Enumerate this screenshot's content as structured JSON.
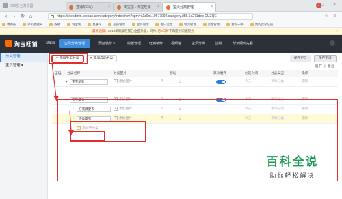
{
  "browser": {
    "app_title": "360安全浏览器",
    "tabs": [
      {
        "label": "直通车中心"
      },
      {
        "label": "淘宝店 - 淘宝旺铺"
      },
      {
        "label": "宝贝分类管理"
      }
    ],
    "notification_count": "4",
    "url": "https://siteadmin.taobao.com/category/index.htm?spm=a1z0m.10677092.category.d55.6a271deb CUZQE",
    "bookmarks": [
      "收藏夹",
      "手机收藏夹",
      "谷歌",
      "淘宝网",
      "直通车",
      "店铺管理",
      "宝贝管理",
      "客户运营",
      "物流管理",
      "资金管理",
      "我的千牛",
      "我的卖家旺铺"
    ]
  },
  "notice": {
    "prefix": "最新通知：",
    "text": "2018年新版旺铺已全面升级，同时",
    "highlight": "4月8日",
    "suffix": "将不再提供旧版服务",
    "close": "×"
  },
  "appnav": {
    "logo": "淘宝旺铺",
    "version": "基础版",
    "items": [
      {
        "label": "宝贝分类管理",
        "active": true
      },
      {
        "label": "页面装修 ▾"
      },
      {
        "label": "模板管理"
      },
      {
        "label": "旺铺装修"
      },
      {
        "label": "视频馆"
      },
      {
        "label": "宝贝分类"
      },
      {
        "label": "营销"
      },
      {
        "label": "帮派版优先看"
      }
    ]
  },
  "sidebar": {
    "items": [
      {
        "label": "分类管理",
        "active": true
      },
      {
        "label": "宝贝管理 ▾"
      }
    ]
  },
  "toolbar": {
    "add_manual": "添加手工分类",
    "add_auto": "添加自动分类",
    "save_changes": "保存更改",
    "preview": "保存更改"
  },
  "expand": {
    "expand": "展开",
    "collapse": "收起"
  },
  "grid": {
    "headers": [
      "全选",
      "分类名称",
      "分类图片",
      "移动",
      "默认展开",
      "创建时间",
      "分类类型",
      "操作"
    ],
    "rows": [
      {
        "name": "宝宝新装",
        "add_image": "添加图片",
        "toggle": true,
        "time": "今天",
        "type": "手动分类",
        "action": "删除",
        "level": "top"
      },
      {
        "name": "宝宝夏衣",
        "add_image": "添加图片",
        "toggle": true,
        "time": "今天",
        "type": "手动分类",
        "action": "删除",
        "level": "top"
      },
      {
        "name": "打底裤夏衣",
        "add_image": "添加图片",
        "toggle": false,
        "time": "今天",
        "type": "手动分类",
        "action": "删除",
        "level": "sub"
      },
      {
        "name": "连体夏衣",
        "add_image": "添加图片",
        "toggle": false,
        "time": "今天",
        "type": "手动分类",
        "action": "删除",
        "level": "sub"
      }
    ],
    "add_sub_category": "添加子分类"
  },
  "watermark": {
    "title": "百科全说",
    "subtitle": "助你轻松解决"
  },
  "colors": {
    "accent": "#2f7bd8",
    "annotation": "#e12e2e",
    "nav_bg": "#2b3039",
    "watermark": "#1f9a58"
  }
}
